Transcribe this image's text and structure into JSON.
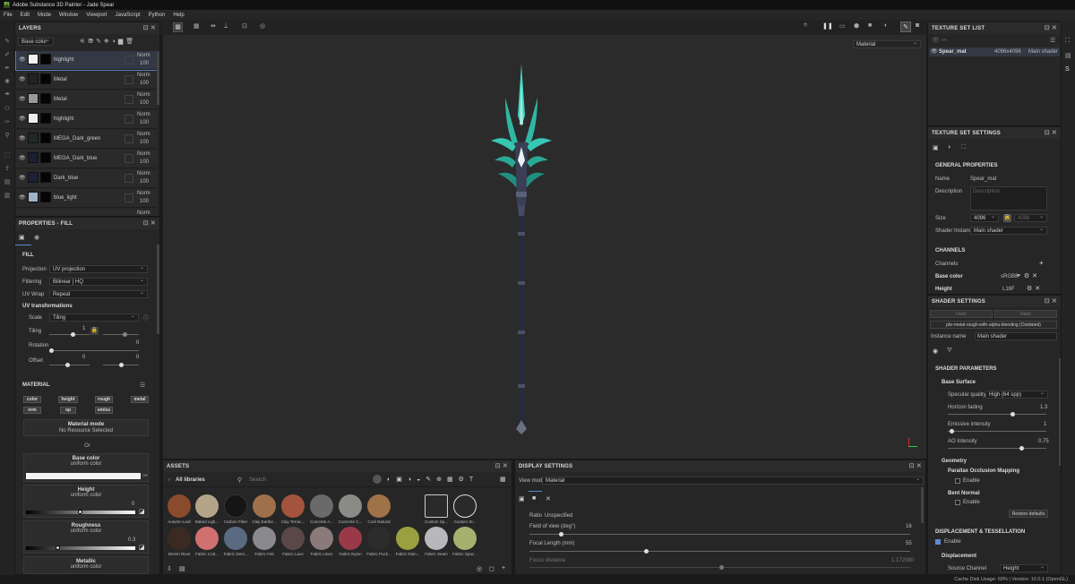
{
  "app": {
    "title": "Adobe Substance 3D Painter - Jade Spear"
  },
  "menu": [
    "File",
    "Edit",
    "Mode",
    "Window",
    "Viewport",
    "JavaScript",
    "Python",
    "Help"
  ],
  "layers": {
    "title": "LAYERS",
    "channel": "Base color",
    "rows": [
      {
        "name": "highlight",
        "blend": "Norm",
        "opacity": "100"
      },
      {
        "name": "Metal",
        "blend": "Norm",
        "opacity": "100"
      },
      {
        "name": "Metal",
        "blend": "Norm",
        "opacity": "100"
      },
      {
        "name": "highlight",
        "blend": "Norm",
        "opacity": "100"
      },
      {
        "name": "MEGA_Dark_green",
        "blend": "Norm",
        "opacity": "100"
      },
      {
        "name": "MEGA_Dark_blue",
        "blend": "Norm",
        "opacity": "100"
      },
      {
        "name": "Dark_blue",
        "blend": "Norm",
        "opacity": "100"
      },
      {
        "name": "blue_light",
        "blend": "Norm",
        "opacity": "100"
      }
    ],
    "partial_blend": "Norm"
  },
  "properties": {
    "title": "PROPERTIES - FILL",
    "fill_header": "FILL",
    "projection_label": "Projection",
    "projection": "UV projection",
    "filtering_label": "Filtering",
    "filtering": "Bilinear | HQ",
    "uvwrap_label": "UV Wrap",
    "uvwrap": "Repeat",
    "uvtrans": "UV transformations",
    "scale_label": "Scale",
    "scale": "Tiling",
    "tiling_label": "Tiling",
    "tiling_value": "1",
    "rotation_label": "Rotation",
    "rotation_value": "0",
    "offset_label": "Offset",
    "offset_u": "0",
    "offset_v": "0",
    "material_header": "MATERIAL",
    "tags": [
      "color",
      "height",
      "rough",
      "metal",
      "nrm",
      "op",
      "emiss"
    ],
    "material_mode_title": "Material mode",
    "material_mode_value": "No Resource Selected",
    "or": "Or",
    "base_color_title": "Base color",
    "base_color_sub": "uniform color",
    "height_title": "Height",
    "height_sub": "uniform color",
    "height_value": "0",
    "roughness_title": "Roughness",
    "roughness_sub": "uniform color",
    "roughness_value": "0.3",
    "metallic_title": "Metallic",
    "metallic_sub": "uniform color"
  },
  "viewport": {
    "mode": "Material"
  },
  "texture_set_list": {
    "title": "TEXTURE SET LIST",
    "row": {
      "name": "Spear_mat",
      "size": "4096x4096",
      "shader": "Main shader"
    }
  },
  "texture_set_settings": {
    "title": "TEXTURE SET SETTINGS",
    "general": "GENERAL PROPERTIES",
    "name_label": "Name",
    "name": "Spear_mat",
    "desc_label": "Description",
    "desc_placeholder": "Description",
    "size_label": "Size",
    "size": "4096",
    "size2": "4096",
    "shader_label": "Shader Instance",
    "shader": "Main shader",
    "channels": "CHANNELS",
    "channels_label": "Channels",
    "ch1": "Base color",
    "ch1_fmt": "sRGB8",
    "ch2": "Height",
    "ch2_fmt": "L16F"
  },
  "shader_settings": {
    "title": "SHADER SETTINGS",
    "tab1": "Undo",
    "tab2": "Redo",
    "shader_file": "pbr-metal-rough-with-alpha-blending (Outdated)",
    "instance_label": "Instance name",
    "instance": "Main shader",
    "params": "SHADER PARAMETERS",
    "base_surface": "Base Surface",
    "spec_label": "Specular quality",
    "spec": "High (64 spp)",
    "horizon_label": "Horizon fading",
    "horizon": "1.3",
    "emissive_label": "Emissive intensity",
    "emissive": "1",
    "ao_label": "AO Intensity",
    "ao": "0.75",
    "geometry": "Geometry",
    "pom": "Parallax Occlusion Mapping",
    "enable": "Enable",
    "bent": "Bent Normal",
    "enable2": "Enable",
    "restore": "Restore defaults",
    "disp": "DISPLACEMENT & TESSELLATION",
    "disp_enable": "Enable",
    "displacement": "Displacement",
    "source_label": "Source Channel",
    "source": "Height"
  },
  "assets": {
    "title": "ASSETS",
    "libs": "All libraries",
    "search_placeholder": "Search",
    "row1": [
      {
        "name": "Autumn Leaf",
        "color": "#8a4a2c"
      },
      {
        "name": "Baked Ligh...",
        "color": "#b4a58a"
      },
      {
        "name": "Carbon Fiber",
        "color": "#151515"
      },
      {
        "name": "Clay Earthe...",
        "color": "#a0704a"
      },
      {
        "name": "Clay Terrac...",
        "color": "#a4543c"
      },
      {
        "name": "Concrete A...",
        "color": "#6a6a6a"
      },
      {
        "name": "Concrete C...",
        "color": "#8a8a86"
      },
      {
        "name": "Cork Natural",
        "color": "#a07248"
      },
      {
        "name": "Custom Sp...",
        "color": "#cfcfcf"
      },
      {
        "name": "Custom St...",
        "color": "#d8d8d8"
      }
    ],
    "row2": [
      {
        "name": "Denim Rivet",
        "color": "#3a2a22"
      },
      {
        "name": "Fabric Cott...",
        "color": "#d07070"
      },
      {
        "name": "Fabric Deni...",
        "color": "#5a6a80"
      },
      {
        "name": "Fabric Felt",
        "color": "#8a8a8e"
      },
      {
        "name": "Fabric Lace",
        "color": "#5a4848"
      },
      {
        "name": "Fabric Linen",
        "color": "#8a7a7a"
      },
      {
        "name": "Fabric Nylon",
        "color": "#9a3a48"
      },
      {
        "name": "Fabric Puck...",
        "color": "#2c2c2c"
      },
      {
        "name": "Fabric Rain...",
        "color": "#9aa040"
      },
      {
        "name": "Fabric Seam",
        "color": "#b8b8bc"
      },
      {
        "name": "Fabric Spac...",
        "color": "#a8b070"
      }
    ]
  },
  "display_settings": {
    "title": "DISPLAY SETTINGS",
    "viewmode_label": "View mode",
    "viewmode": "Material",
    "ratio_label": "Ratio",
    "ratio": "Unspecified",
    "fov_label": "Field of view (deg°)",
    "fov": "16",
    "focal_label": "Focal Length (mm)",
    "focal": "55",
    "focus_label": "Focus distance",
    "focus": "1.172080"
  },
  "status": {
    "text": "Cache Disk Usage:   69% | Version: 10.0.1 (OpenGL)"
  }
}
